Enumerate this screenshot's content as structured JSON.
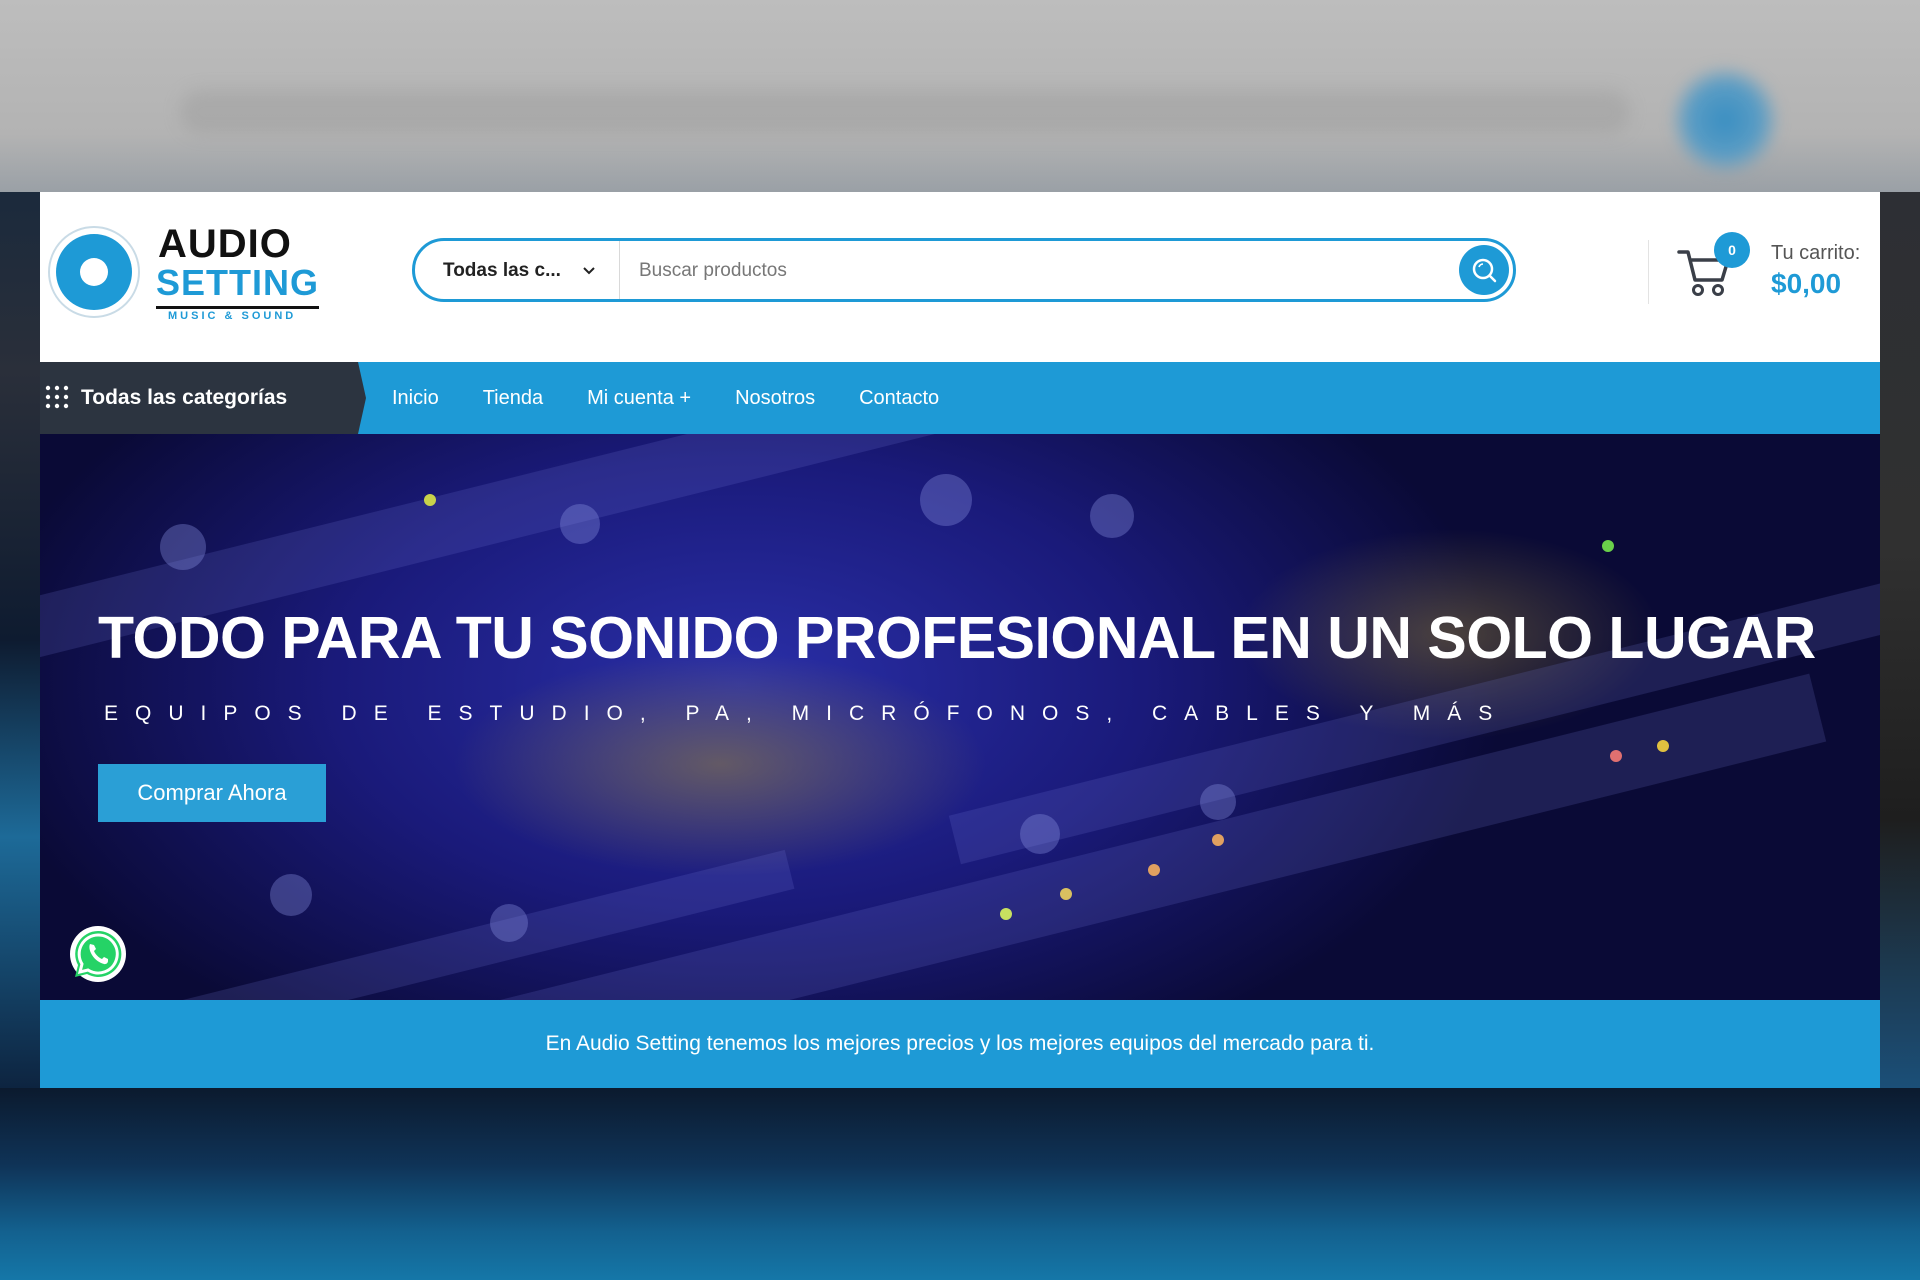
{
  "brand": {
    "name_line1": "AUDIO",
    "name_line2": "SETTING",
    "tagline": "MUSIC & SOUND",
    "accent_color": "#1e9ad6",
    "dark_color": "#2c3440"
  },
  "search": {
    "category_label": "Todas las c...",
    "placeholder": "Buscar productos",
    "button_icon": "search-icon"
  },
  "cart": {
    "count": "0",
    "label": "Tu carrito:",
    "total": "$0,00",
    "icon": "cart-icon"
  },
  "nav": {
    "all_categories": "Todas las categorías",
    "items": [
      {
        "label": "Inicio"
      },
      {
        "label": "Tienda"
      },
      {
        "label": "Mi cuenta +"
      },
      {
        "label": "Nosotros"
      },
      {
        "label": "Contacto"
      }
    ]
  },
  "hero": {
    "title": "TODO PARA TU SONIDO PROFESIONAL EN UN SOLO LUGAR",
    "subtitle": "EQUIPOS DE ESTUDIO, PA, MICRÓFONOS, CABLES Y MÁS",
    "cta": "Comprar Ahora"
  },
  "whatsapp": {
    "icon": "whatsapp-icon"
  },
  "banner": {
    "text": "En Audio Setting tenemos los mejores precios y los mejores equipos del mercado para ti."
  }
}
